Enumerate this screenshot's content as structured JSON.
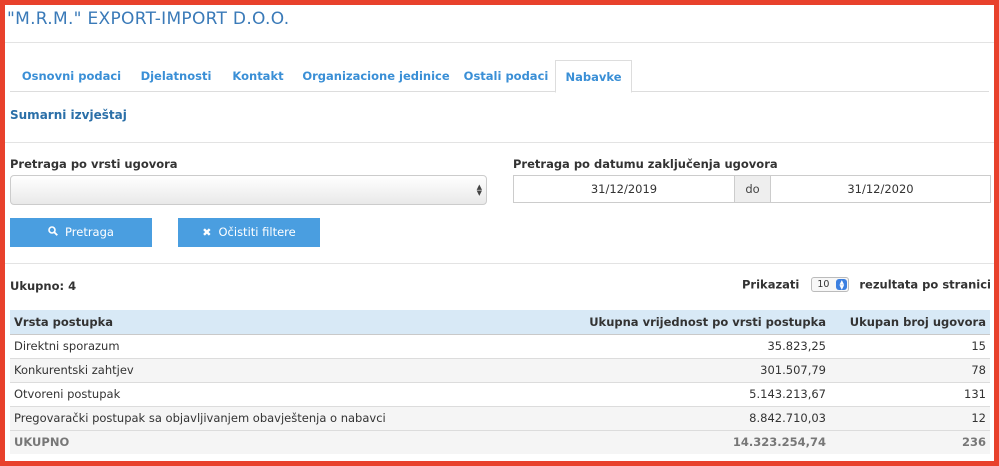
{
  "header": {
    "company": "\"M.R.M.\" EXPORT-IMPORT D.O.O."
  },
  "tabs": [
    {
      "label": "Osnovni podaci",
      "active": false
    },
    {
      "label": "Djelatnosti",
      "active": false
    },
    {
      "label": "Kontakt",
      "active": false
    },
    {
      "label": "Organizacione jedinice",
      "active": false
    },
    {
      "label": "Ostali podaci",
      "active": false
    },
    {
      "label": "Nabavke",
      "active": true
    }
  ],
  "section_title": "Sumarni izvještaj",
  "filters": {
    "contract_type_label": "Pretraga po vrsti ugovora",
    "contract_type_value": "",
    "date_label": "Pretraga po datumu zaključenja ugovora",
    "date_from": "31/12/2019",
    "date_separator": "do",
    "date_to": "31/12/2020",
    "search_button": "Pretraga",
    "clear_button": "Očistiti filtere"
  },
  "summary": {
    "total_label": "Ukupno: 4",
    "show_label": "Prikazati",
    "page_size": "10",
    "per_page_label": "rezultata po stranici"
  },
  "table": {
    "headers": [
      "Vrsta postupka",
      "Ukupna vrijednost po vrsti postupka",
      "Ukupan broj ugovora"
    ],
    "rows": [
      [
        "Direktni sporazum",
        "35.823,25",
        "15"
      ],
      [
        "Konkurentski zahtjev",
        "301.507,79",
        "78"
      ],
      [
        "Otvoreni postupak",
        "5.143.213,67",
        "131"
      ],
      [
        "Pregovarački postupak sa objavljivanjem obavještenja o nabavci",
        "8.842.710,03",
        "12"
      ]
    ],
    "total_row": [
      "UKUPNO",
      "14.323.254,74",
      "236"
    ]
  },
  "colors": {
    "accent": "#4a9ee0",
    "tab_text": "#3a8fd6",
    "header_bg": "#d8e9f6",
    "border_red": "#e8412c"
  },
  "icons": {
    "search": "search-icon",
    "clear": "close-icon"
  }
}
